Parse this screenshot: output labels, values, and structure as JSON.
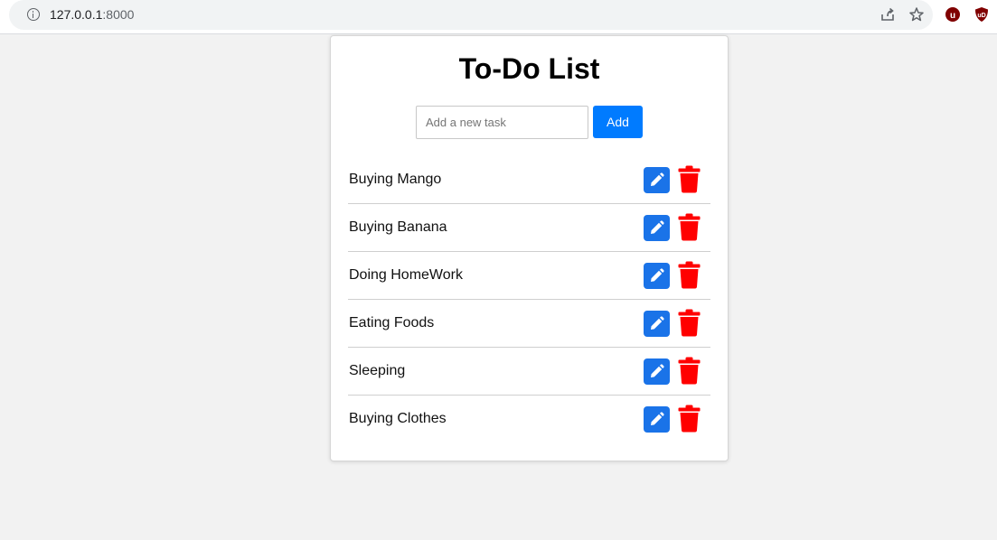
{
  "browser": {
    "url_host": "127.0.0.1",
    "url_port": ":8000"
  },
  "app": {
    "title": "To-Do List",
    "input_placeholder": "Add a new task",
    "add_label": "Add"
  },
  "tasks": [
    {
      "label": "Buying Mango"
    },
    {
      "label": "Buying Banana"
    },
    {
      "label": "Doing HomeWork"
    },
    {
      "label": "Eating Foods"
    },
    {
      "label": "Sleeping"
    },
    {
      "label": "Buying Clothes"
    }
  ],
  "colors": {
    "accent": "#007bff",
    "edit": "#1a73e8",
    "delete": "#ff0000"
  },
  "icons": {
    "edit": "pencil-icon",
    "delete": "trash-icon"
  }
}
